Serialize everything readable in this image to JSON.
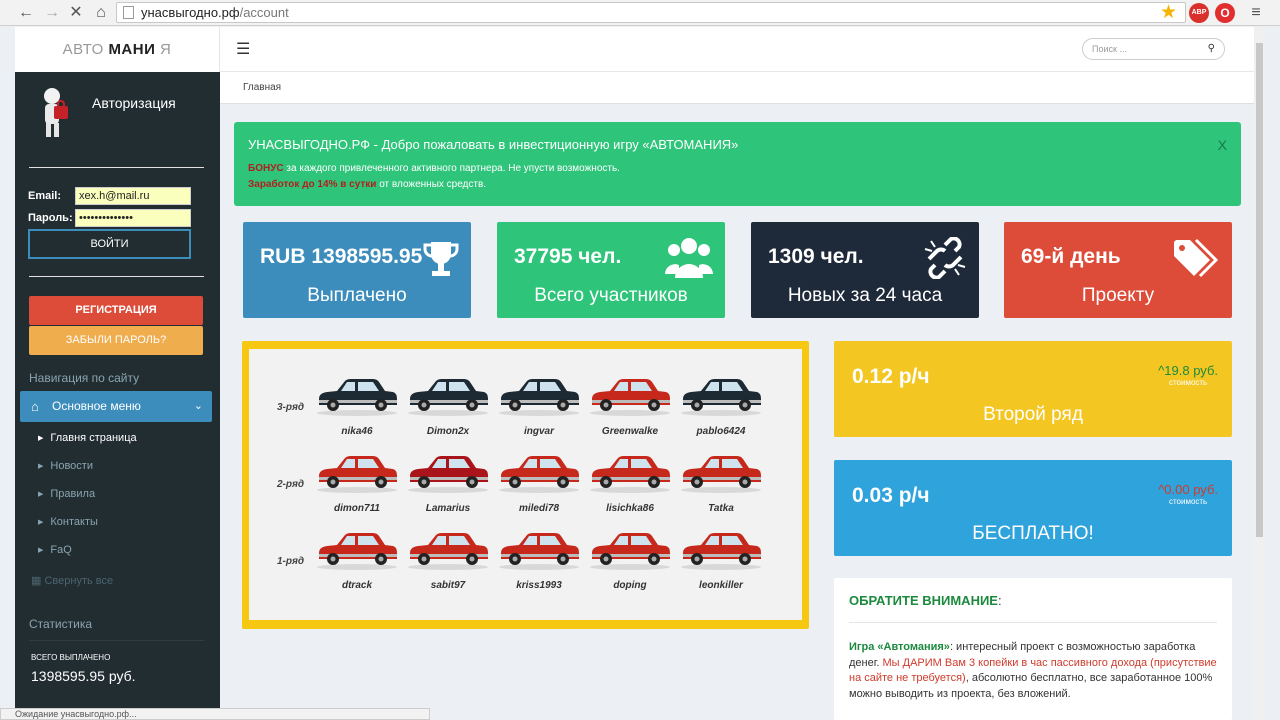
{
  "browser": {
    "url_domain": "унасвыгодно.рф",
    "url_path": "/account",
    "ext1": "ABP",
    "status_text": "Ожидание унасвыгодно.рф..."
  },
  "logo": {
    "part1": "АВТО ",
    "part2": "МАНИ",
    "part3": " Я"
  },
  "sidebar": {
    "auth_title": "Авторизация",
    "email_label": "Email:",
    "email_value": "xex.h@mail.ru",
    "password_label": "Пароль:",
    "password_value": "••••••••••••••",
    "login_button": "ВОЙТИ",
    "register_button": "РЕГИСТРАЦИЯ",
    "forgot_button": "ЗАБЫЛИ ПАРОЛЬ?",
    "nav_heading": "Навигация по сайту",
    "main_menu": "Основное меню",
    "menu_items": [
      "Главня страница",
      "Новости",
      "Правила",
      "Контакты",
      "FaQ"
    ],
    "collapse_all": "Свернуть все",
    "stats_heading": "Статистика",
    "total_paid_label": "ВСЕГО ВЫПЛАЧЕНО",
    "total_paid_value": "1398595.95 руб."
  },
  "header": {
    "search_placeholder": "Поиск ...",
    "breadcrumb": "Главная"
  },
  "alert": {
    "title": "УНАСВЫГОДНО.РФ - Добро пожаловать в инвестиционную игру «АВТОМАНИЯ»",
    "bonus_word": "БОНУС",
    "bonus_text": " за каждого привлеченного активного партнера. Не упусти возможность.",
    "earn_red": "Заработок до 14% в сутки",
    "earn_text": " от вложенных средств.",
    "close": "X"
  },
  "stats": [
    {
      "value": "RUB 1398595.95",
      "label": "Выплачено",
      "color": "#3c8dbc",
      "icon": "trophy-icon"
    },
    {
      "value": "37795 чел.",
      "label": "Всего участников",
      "color": "#2ec47a",
      "icon": "users-icon"
    },
    {
      "value": "1309 чел.",
      "label": "Новых за 24 часа",
      "color": "#1e2a3a",
      "icon": "unlink-icon"
    },
    {
      "value": "69-й день",
      "label": "Проекту",
      "color": "#dd4b39",
      "icon": "tags-icon"
    }
  ],
  "garage": {
    "row_labels": [
      "3-ряд",
      "2-ряд",
      "1-ряд"
    ],
    "rows": [
      [
        "nika46",
        "Dimon2x",
        "ingvar",
        "Greenwalke",
        "pablo6424"
      ],
      [
        "dimon711",
        "Lamarius",
        "miledi78",
        "lisichka86",
        "Tatka"
      ],
      [
        "dtrack",
        "sabit97",
        "kriss1993",
        "doping",
        "leonkiller"
      ]
    ],
    "car_colors": [
      [
        "#1d2a33",
        "#1d2a33",
        "#1d2a33",
        "#c7281c",
        "#1d2a33"
      ],
      [
        "#c7281c",
        "#a8141a",
        "#c7281c",
        "#c7281c",
        "#c7281c"
      ],
      [
        "#c7281c",
        "#c7281c",
        "#c7281c",
        "#c7281c",
        "#c7281c"
      ]
    ]
  },
  "cards": [
    {
      "rate": "0.12 р/ч",
      "price": "19.8 руб.",
      "price_label": "стоимость",
      "label": "Второй ряд",
      "color": "#f3c622",
      "price_color": "#1c8a3e"
    },
    {
      "rate": "0.03 р/ч",
      "price": "0.00 руб.",
      "price_label": "стоимость",
      "label": "БЕСПЛАТНО!",
      "color": "#2fa3dc",
      "price_color": "#d03b2c"
    }
  ],
  "notice": {
    "title": "ОБРАТИТЕ ВНИМАНИЕ",
    "colon": ":",
    "game": "Игра «Автомания»",
    "t1": ": интересный проект с возможностью заработка денег. ",
    "red": "Мы ДАРИМ Вам 3 копейки в час пассивного дохода (присутствие на сайте не требуется)",
    "t2": ", абсолютно бесплатно, все заработанное 100% можно выводить из проекта, без вложений."
  }
}
